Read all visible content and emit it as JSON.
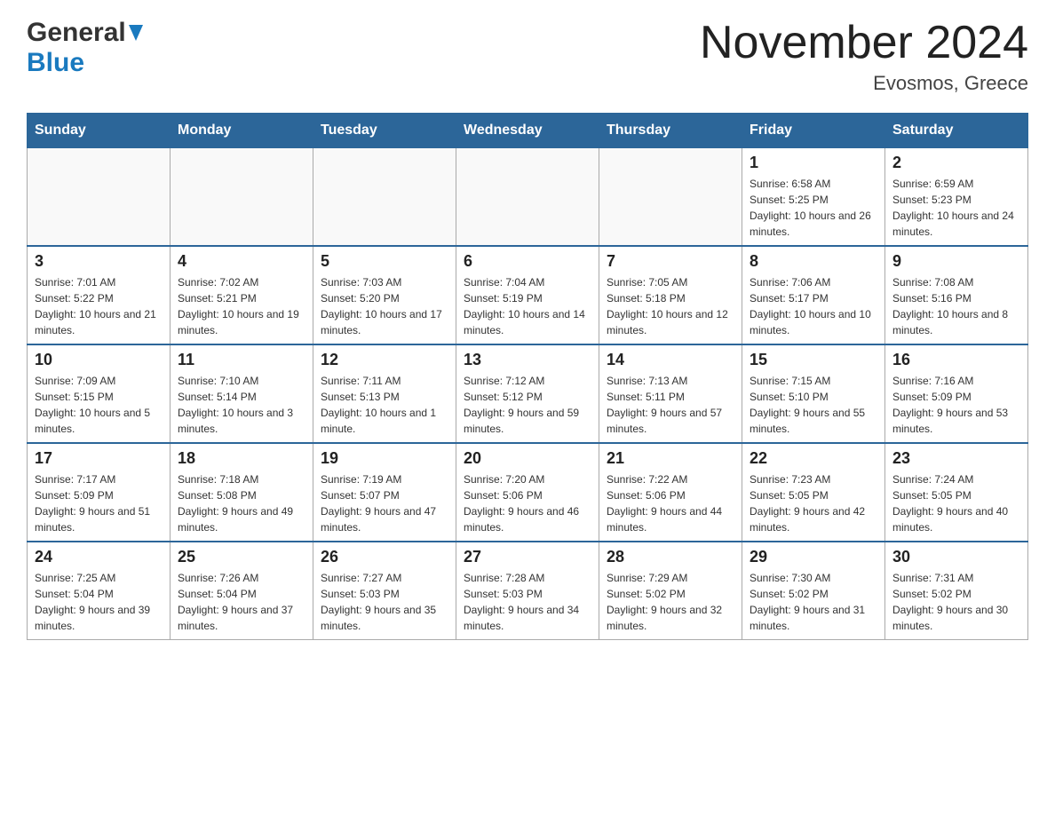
{
  "header": {
    "logo_general": "General",
    "logo_blue": "Blue",
    "month_year": "November 2024",
    "location": "Evosmos, Greece"
  },
  "weekdays": [
    "Sunday",
    "Monday",
    "Tuesday",
    "Wednesday",
    "Thursday",
    "Friday",
    "Saturday"
  ],
  "weeks": [
    {
      "days": [
        {
          "number": "",
          "info": ""
        },
        {
          "number": "",
          "info": ""
        },
        {
          "number": "",
          "info": ""
        },
        {
          "number": "",
          "info": ""
        },
        {
          "number": "",
          "info": ""
        },
        {
          "number": "1",
          "info": "Sunrise: 6:58 AM\nSunset: 5:25 PM\nDaylight: 10 hours and 26 minutes."
        },
        {
          "number": "2",
          "info": "Sunrise: 6:59 AM\nSunset: 5:23 PM\nDaylight: 10 hours and 24 minutes."
        }
      ]
    },
    {
      "days": [
        {
          "number": "3",
          "info": "Sunrise: 7:01 AM\nSunset: 5:22 PM\nDaylight: 10 hours and 21 minutes."
        },
        {
          "number": "4",
          "info": "Sunrise: 7:02 AM\nSunset: 5:21 PM\nDaylight: 10 hours and 19 minutes."
        },
        {
          "number": "5",
          "info": "Sunrise: 7:03 AM\nSunset: 5:20 PM\nDaylight: 10 hours and 17 minutes."
        },
        {
          "number": "6",
          "info": "Sunrise: 7:04 AM\nSunset: 5:19 PM\nDaylight: 10 hours and 14 minutes."
        },
        {
          "number": "7",
          "info": "Sunrise: 7:05 AM\nSunset: 5:18 PM\nDaylight: 10 hours and 12 minutes."
        },
        {
          "number": "8",
          "info": "Sunrise: 7:06 AM\nSunset: 5:17 PM\nDaylight: 10 hours and 10 minutes."
        },
        {
          "number": "9",
          "info": "Sunrise: 7:08 AM\nSunset: 5:16 PM\nDaylight: 10 hours and 8 minutes."
        }
      ]
    },
    {
      "days": [
        {
          "number": "10",
          "info": "Sunrise: 7:09 AM\nSunset: 5:15 PM\nDaylight: 10 hours and 5 minutes."
        },
        {
          "number": "11",
          "info": "Sunrise: 7:10 AM\nSunset: 5:14 PM\nDaylight: 10 hours and 3 minutes."
        },
        {
          "number": "12",
          "info": "Sunrise: 7:11 AM\nSunset: 5:13 PM\nDaylight: 10 hours and 1 minute."
        },
        {
          "number": "13",
          "info": "Sunrise: 7:12 AM\nSunset: 5:12 PM\nDaylight: 9 hours and 59 minutes."
        },
        {
          "number": "14",
          "info": "Sunrise: 7:13 AM\nSunset: 5:11 PM\nDaylight: 9 hours and 57 minutes."
        },
        {
          "number": "15",
          "info": "Sunrise: 7:15 AM\nSunset: 5:10 PM\nDaylight: 9 hours and 55 minutes."
        },
        {
          "number": "16",
          "info": "Sunrise: 7:16 AM\nSunset: 5:09 PM\nDaylight: 9 hours and 53 minutes."
        }
      ]
    },
    {
      "days": [
        {
          "number": "17",
          "info": "Sunrise: 7:17 AM\nSunset: 5:09 PM\nDaylight: 9 hours and 51 minutes."
        },
        {
          "number": "18",
          "info": "Sunrise: 7:18 AM\nSunset: 5:08 PM\nDaylight: 9 hours and 49 minutes."
        },
        {
          "number": "19",
          "info": "Sunrise: 7:19 AM\nSunset: 5:07 PM\nDaylight: 9 hours and 47 minutes."
        },
        {
          "number": "20",
          "info": "Sunrise: 7:20 AM\nSunset: 5:06 PM\nDaylight: 9 hours and 46 minutes."
        },
        {
          "number": "21",
          "info": "Sunrise: 7:22 AM\nSunset: 5:06 PM\nDaylight: 9 hours and 44 minutes."
        },
        {
          "number": "22",
          "info": "Sunrise: 7:23 AM\nSunset: 5:05 PM\nDaylight: 9 hours and 42 minutes."
        },
        {
          "number": "23",
          "info": "Sunrise: 7:24 AM\nSunset: 5:05 PM\nDaylight: 9 hours and 40 minutes."
        }
      ]
    },
    {
      "days": [
        {
          "number": "24",
          "info": "Sunrise: 7:25 AM\nSunset: 5:04 PM\nDaylight: 9 hours and 39 minutes."
        },
        {
          "number": "25",
          "info": "Sunrise: 7:26 AM\nSunset: 5:04 PM\nDaylight: 9 hours and 37 minutes."
        },
        {
          "number": "26",
          "info": "Sunrise: 7:27 AM\nSunset: 5:03 PM\nDaylight: 9 hours and 35 minutes."
        },
        {
          "number": "27",
          "info": "Sunrise: 7:28 AM\nSunset: 5:03 PM\nDaylight: 9 hours and 34 minutes."
        },
        {
          "number": "28",
          "info": "Sunrise: 7:29 AM\nSunset: 5:02 PM\nDaylight: 9 hours and 32 minutes."
        },
        {
          "number": "29",
          "info": "Sunrise: 7:30 AM\nSunset: 5:02 PM\nDaylight: 9 hours and 31 minutes."
        },
        {
          "number": "30",
          "info": "Sunrise: 7:31 AM\nSunset: 5:02 PM\nDaylight: 9 hours and 30 minutes."
        }
      ]
    }
  ]
}
